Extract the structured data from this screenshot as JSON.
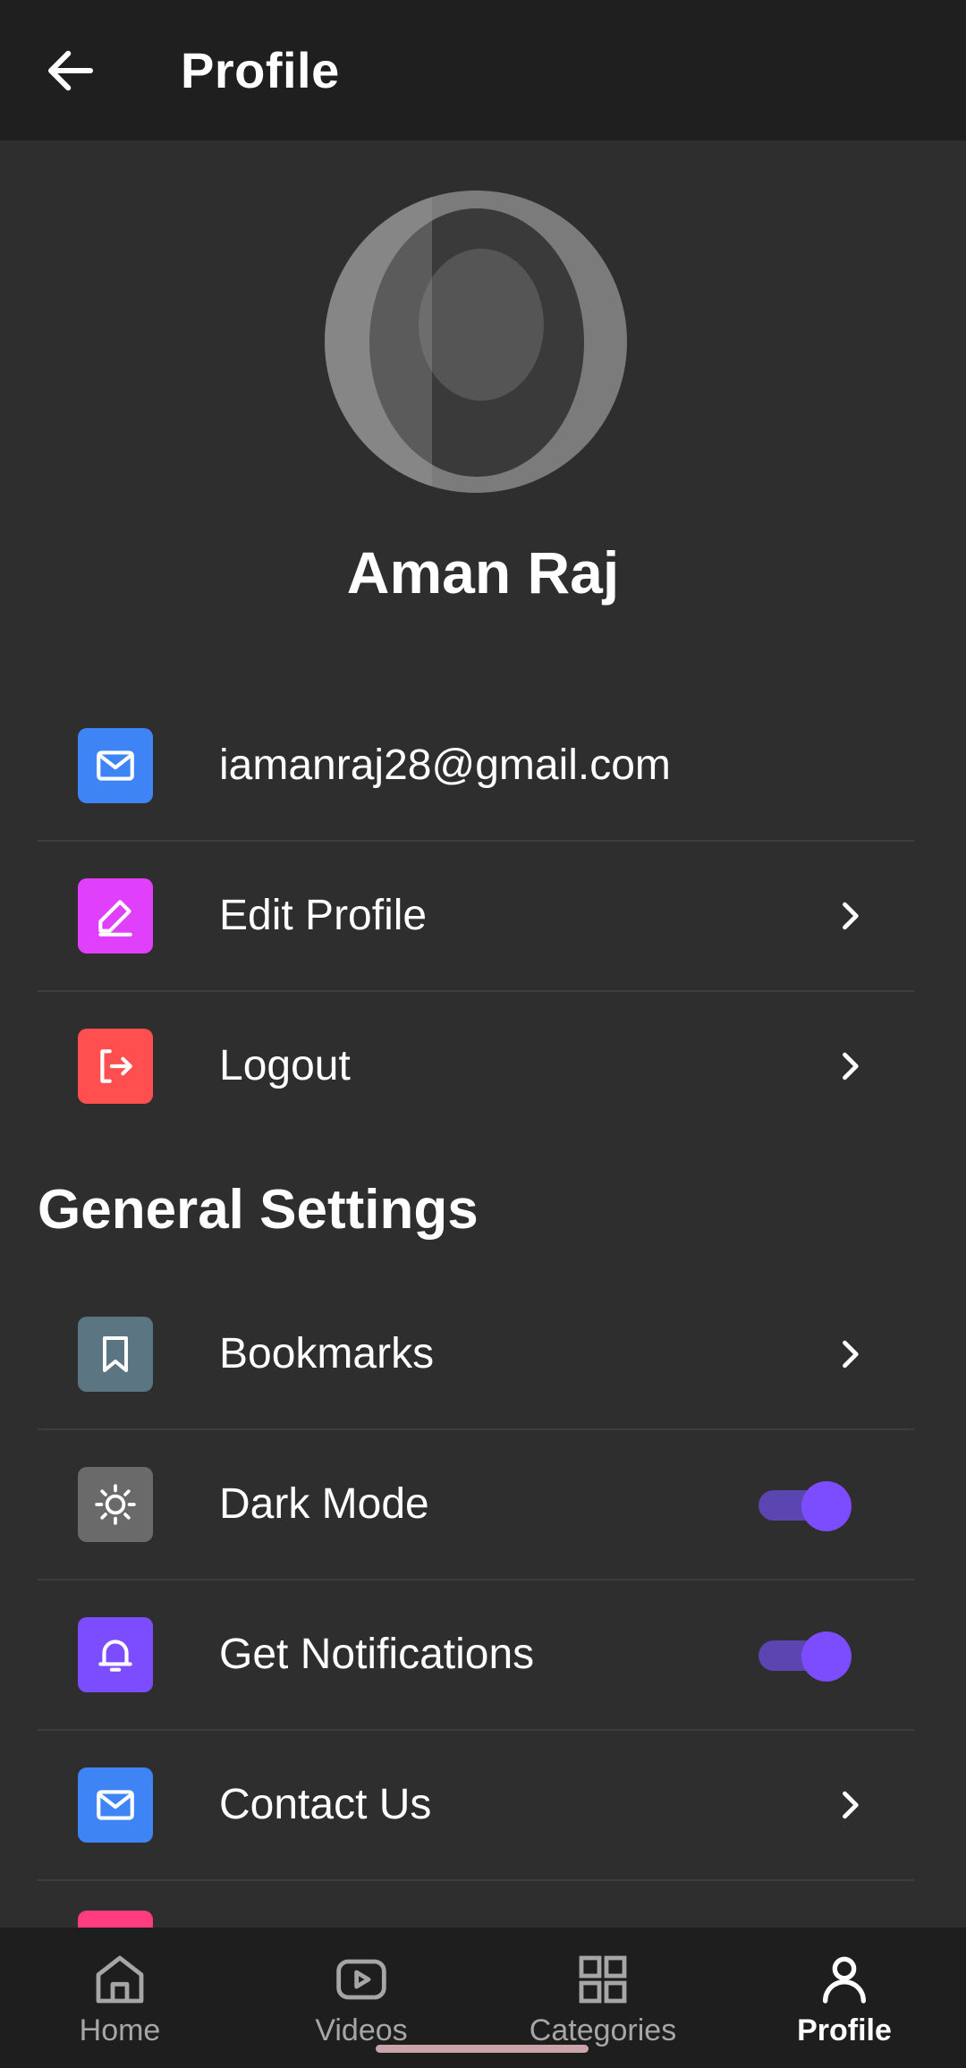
{
  "appbar": {
    "title": "Profile"
  },
  "user": {
    "name": "Aman Raj"
  },
  "account_rows": [
    {
      "label": "iamanraj28@gmail.com",
      "icon": "mail-icon",
      "color": "#3f84f4"
    },
    {
      "label": "Edit Profile",
      "icon": "edit-icon",
      "color": "#e040fb"
    },
    {
      "label": "Logout",
      "icon": "logout-icon",
      "color": "#ff4f4f"
    }
  ],
  "general_settings": {
    "title": "General Settings",
    "rows": [
      {
        "label": "Bookmarks",
        "icon": "bookmark-icon",
        "color": "#5b7582"
      },
      {
        "label": "Dark Mode",
        "icon": "sun-icon",
        "color": "#6a6a6a",
        "toggle_on": true
      },
      {
        "label": "Get Notifications",
        "icon": "bell-icon",
        "color": "#7c4dff",
        "toggle_on": true
      },
      {
        "label": "Contact Us",
        "icon": "mail-icon",
        "color": "#3f84f4"
      }
    ]
  },
  "bottom_nav": [
    {
      "label": "Home",
      "icon": "home-icon",
      "active": false
    },
    {
      "label": "Videos",
      "icon": "video-icon",
      "active": false
    },
    {
      "label": "Categories",
      "icon": "grid-icon",
      "active": false
    },
    {
      "label": "Profile",
      "icon": "person-icon",
      "active": true
    }
  ],
  "colors": {
    "accent": "#7c4dff",
    "background": "#2e2e2f",
    "appbar": "#1f1f1f"
  }
}
